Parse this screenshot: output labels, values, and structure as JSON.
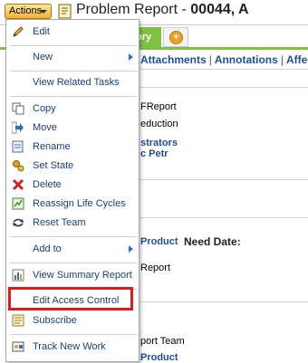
{
  "header": {
    "actions_label": "Actions",
    "title_prefix": "Problem Report - ",
    "title_id": "00044, A"
  },
  "tabs": {
    "partial_label": "ory"
  },
  "links": {
    "attachments": "Attachments",
    "annotations": "Annotations",
    "affects": "Affect"
  },
  "background": {
    "t1": "FReport",
    "t2": "eduction",
    "t3": "strators",
    "t4": "c Petr",
    "t5": "Product",
    "t6": "Need Date:",
    "t7": "Report",
    "t8": "port Team",
    "t9": "Product"
  },
  "menu": {
    "edit": "Edit",
    "new": "New",
    "view_related_tasks": "View Related Tasks",
    "copy": "Copy",
    "move": "Move",
    "rename": "Rename",
    "set_state": "Set State",
    "delete": "Delete",
    "reassign_life_cycles": "Reassign Life Cycles",
    "reset_team": "Reset Team",
    "add_to": "Add to",
    "view_summary_report": "View Summary Report",
    "edit_access_control": "Edit Access Control",
    "subscribe": "Subscribe",
    "track_new_work": "Track New Work"
  },
  "colors": {
    "highlight": "#e21a1a",
    "tab_green": "#7fc143",
    "link_blue": "#1f4e9c"
  }
}
